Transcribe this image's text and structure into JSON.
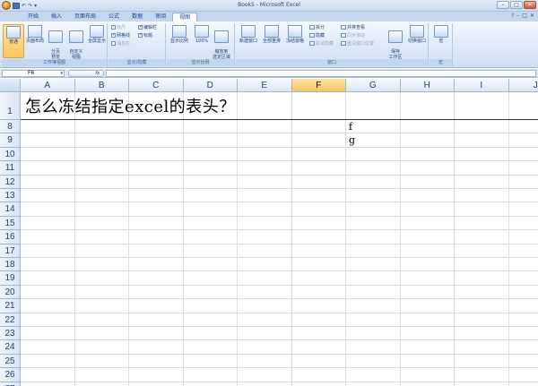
{
  "titlebar": {
    "title": "Book5 - Microsoft Excel",
    "qat": [
      "▾",
      "↶",
      "↷",
      "▾"
    ],
    "controls": [
      "–",
      "□",
      "✕"
    ]
  },
  "tabs": [
    {
      "label": "开始",
      "active": false
    },
    {
      "label": "插入",
      "active": false
    },
    {
      "label": "页面布局",
      "active": false
    },
    {
      "label": "公式",
      "active": false
    },
    {
      "label": "数据",
      "active": false
    },
    {
      "label": "审阅",
      "active": false
    },
    {
      "label": "视图",
      "active": true
    }
  ],
  "tab_right": [
    "?",
    "–",
    "□",
    "✕"
  ],
  "ribbon": {
    "groups": {
      "workbook_views": {
        "label": "工作簿视图",
        "buttons": [
          {
            "label": "普通",
            "active": true,
            "icon": "normal-view-icon"
          },
          {
            "label": "页面布局",
            "active": false,
            "icon": "page-layout-icon"
          },
          {
            "label": "分页\n预览",
            "active": false,
            "icon": "page-break-icon"
          },
          {
            "label": "自定义\n视图",
            "active": false,
            "icon": "custom-views-icon"
          },
          {
            "label": "全屏显示",
            "active": false,
            "icon": "full-screen-icon"
          }
        ]
      },
      "show_hide": {
        "label": "显示/隐藏",
        "items": [
          {
            "label": "标尺",
            "checked": true,
            "dim": true
          },
          {
            "label": "网格线",
            "checked": true,
            "dim": false
          },
          {
            "label": "消息栏",
            "checked": false,
            "dim": true
          },
          {
            "label": "编辑栏",
            "checked": true,
            "dim": false
          },
          {
            "label": "标题",
            "checked": true,
            "dim": false
          }
        ]
      },
      "zoom": {
        "label": "显示比例",
        "buttons": [
          {
            "label": "显示比例",
            "icon": "zoom-icon"
          },
          {
            "label": "100%",
            "icon": "zoom-100-icon"
          },
          {
            "label": "缩放到\n选定区域",
            "icon": "zoom-selection-icon"
          }
        ]
      },
      "window": {
        "label": "窗口",
        "buttons": [
          {
            "label": "新建窗口",
            "icon": "new-window-icon"
          },
          {
            "label": "全部重排",
            "icon": "arrange-all-icon"
          },
          {
            "label": "冻结窗格",
            "icon": "freeze-panes-icon"
          }
        ],
        "small": [
          {
            "label": "拆分",
            "dim": false
          },
          {
            "label": "隐藏",
            "dim": false
          },
          {
            "label": "取消隐藏",
            "dim": true
          },
          {
            "label": "并排查看",
            "dim": false
          },
          {
            "label": "同步滚动",
            "dim": true
          },
          {
            "label": "重设窗口位置",
            "dim": true
          }
        ],
        "more": [
          {
            "label": "保存\n工作区",
            "icon": "save-workspace-icon"
          },
          {
            "label": "切换窗口",
            "icon": "switch-windows-icon"
          }
        ]
      },
      "macros": {
        "label": "宏",
        "buttons": [
          {
            "label": "宏",
            "icon": "macros-icon"
          }
        ]
      }
    }
  },
  "formula_bar": {
    "name_box": "F6",
    "fx": "fx",
    "value": ""
  },
  "grid": {
    "columns": [
      "A",
      "B",
      "C",
      "D",
      "E",
      "F",
      "G",
      "H",
      "I",
      "J"
    ],
    "selected_column": "F",
    "rows": [
      "1",
      "8",
      "9",
      "10",
      "11",
      "12",
      "13",
      "14",
      "15",
      "16",
      "17",
      "18",
      "19",
      "20",
      "21",
      "22",
      "23",
      "24",
      "25",
      "26",
      "27"
    ],
    "cell_a1": "怎么冻结指定excel的表头？",
    "cell_g8": "f",
    "cell_g9": "g"
  }
}
